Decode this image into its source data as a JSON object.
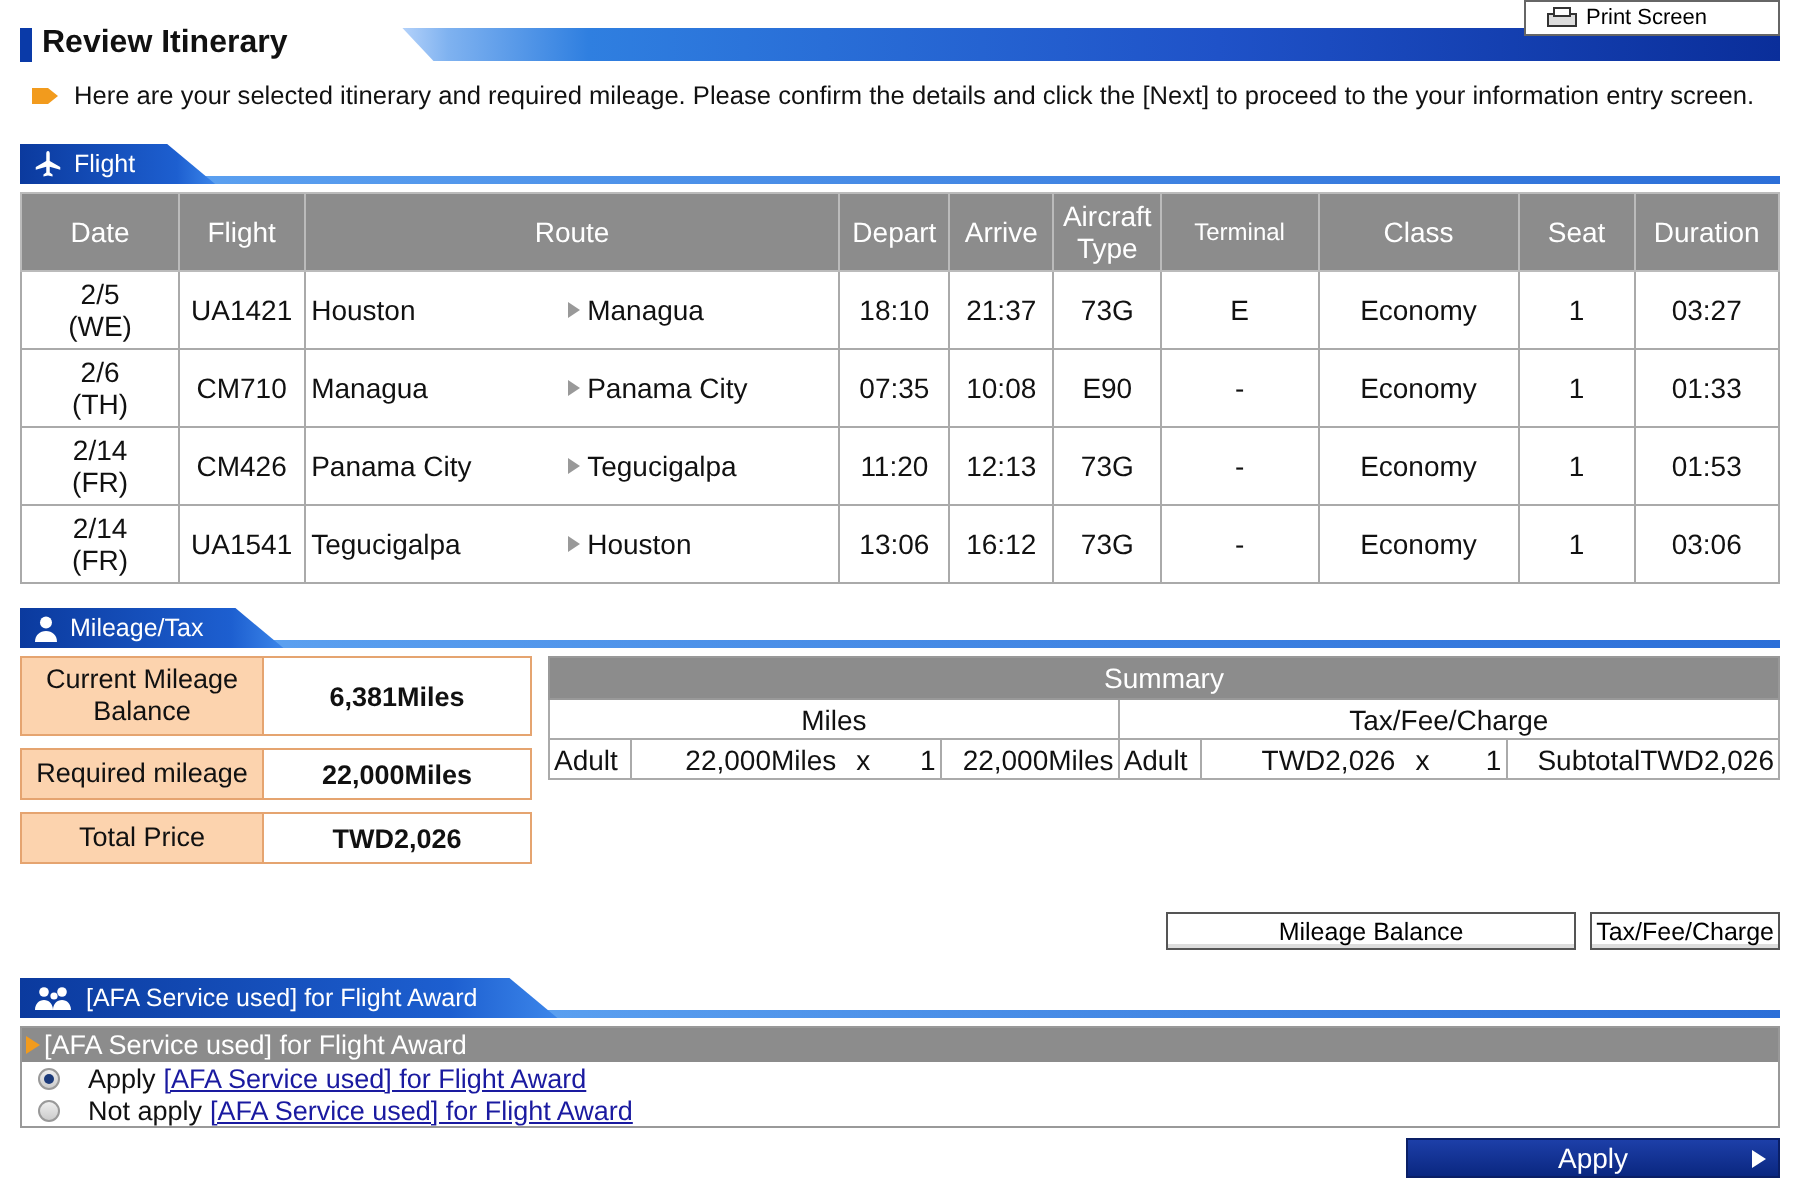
{
  "header": {
    "title": "Review Itinerary",
    "print_button": "Print Screen"
  },
  "intro": "Here are your selected itinerary and required mileage. Please confirm the details and click the [Next] to proceed to the your information entry screen.",
  "flight_section": {
    "title": "Flight",
    "columns": [
      "Date",
      "Flight",
      "Route",
      "Depart",
      "Arrive",
      "Aircraft Type",
      "Terminal",
      "Class",
      "Seat",
      "Duration"
    ],
    "rows": [
      {
        "date": "2/5",
        "day": "(WE)",
        "flight": "UA1421",
        "origin": "Houston",
        "destination": "Managua",
        "depart": "18:10",
        "arrive": "21:37",
        "aircraft": "73G",
        "terminal": "E",
        "class": "Economy",
        "seat": "1",
        "duration": "03:27"
      },
      {
        "date": "2/6",
        "day": "(TH)",
        "flight": "CM710",
        "origin": "Managua",
        "destination": "Panama City",
        "depart": "07:35",
        "arrive": "10:08",
        "aircraft": "E90",
        "terminal": "-",
        "class": "Economy",
        "seat": "1",
        "duration": "01:33"
      },
      {
        "date": "2/14",
        "day": "(FR)",
        "flight": "CM426",
        "origin": "Panama City",
        "destination": "Tegucigalpa",
        "depart": "11:20",
        "arrive": "12:13",
        "aircraft": "73G",
        "terminal": "-",
        "class": "Economy",
        "seat": "1",
        "duration": "01:53"
      },
      {
        "date": "2/14",
        "day": "(FR)",
        "flight": "UA1541",
        "origin": "Tegucigalpa",
        "destination": "Houston",
        "depart": "13:06",
        "arrive": "16:12",
        "aircraft": "73G",
        "terminal": "-",
        "class": "Economy",
        "seat": "1",
        "duration": "03:06"
      }
    ]
  },
  "mileage_section": {
    "title": "Mileage/Tax",
    "balances": [
      {
        "label": "Current Mileage Balance",
        "value": "6,381Miles"
      },
      {
        "label": "Required mileage",
        "value": "22,000Miles"
      },
      {
        "label": "Total Price",
        "value": "TWD2,026"
      }
    ],
    "summary": {
      "title": "Summary",
      "groups": [
        {
          "heading": "Miles",
          "passenger": "Adult",
          "amount": "22,000Miles",
          "times": "x",
          "count": "1",
          "total": "22,000Miles"
        },
        {
          "heading": "Tax/Fee/Charge",
          "passenger": "Adult",
          "amount": "TWD2,026",
          "times": "x",
          "count": "1",
          "total": "SubtotalTWD2,026"
        }
      ]
    },
    "buttons": [
      "Mileage Balance",
      "Tax/Fee/Charge"
    ]
  },
  "afa_section": {
    "title": "[AFA Service used] for Flight Award",
    "panel_title": "[AFA Service used] for Flight Award",
    "options": [
      {
        "prefix": "Apply",
        "link": "[AFA Service used] for Flight Award",
        "selected": true
      },
      {
        "prefix": "Not apply",
        "link": "[AFA Service used] for Flight Award",
        "selected": false
      }
    ],
    "apply_button": "Apply"
  }
}
